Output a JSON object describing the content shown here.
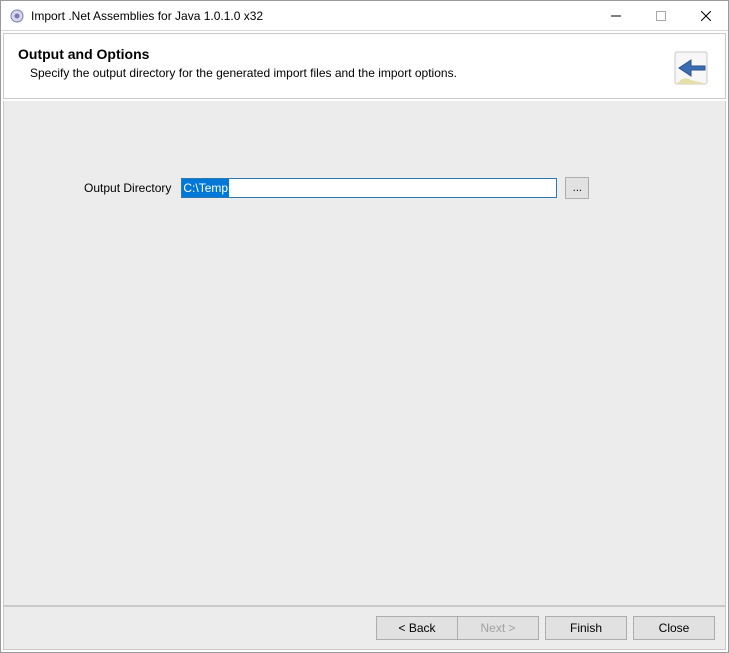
{
  "titlebar": {
    "title": "Import .Net Assemblies for Java 1.0.1.0 x32"
  },
  "header": {
    "title": "Output and Options",
    "description": "Specify the output directory for the generated import files and the import options."
  },
  "form": {
    "output_label": "Output Directory",
    "output_value": "C:\\Temp",
    "browse_label": "..."
  },
  "buttons": {
    "back": "< Back",
    "next": "Next >",
    "finish": "Finish",
    "close": "Close"
  }
}
